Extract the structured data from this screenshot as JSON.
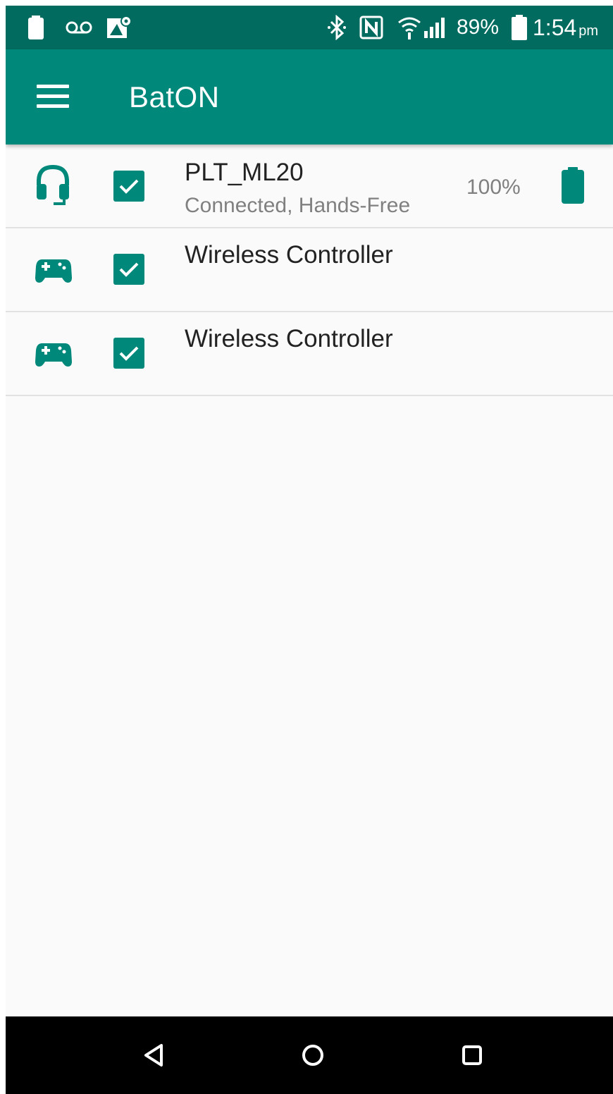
{
  "status_bar": {
    "signal_percent": "89%",
    "time": "1:54",
    "ampm": "pm",
    "icons": [
      "battery-icon",
      "voicemail-icon",
      "maps-icon",
      "bluetooth-icon",
      "nfc-icon",
      "wifi-icon",
      "cell-signal-icon",
      "battery-icon"
    ]
  },
  "app_bar": {
    "title": "BatON",
    "menu_icon": "menu-icon"
  },
  "devices": [
    {
      "name": "PLT_ML20",
      "status": "Connected, Hands-Free",
      "battery": "100%",
      "icon": "headset-icon",
      "checked": true
    },
    {
      "name": "Wireless Controller",
      "status": "",
      "battery": "",
      "icon": "gamepad-icon",
      "checked": true
    },
    {
      "name": "Wireless Controller",
      "status": "",
      "battery": "",
      "icon": "gamepad-icon",
      "checked": true
    }
  ],
  "colors": {
    "status_bar": "#006b5e",
    "primary": "#00897b",
    "background": "#fafafa",
    "nav_bar": "#000000"
  },
  "nav_bar": {
    "back": "back-icon",
    "home": "home-icon",
    "recents": "recents-icon"
  }
}
